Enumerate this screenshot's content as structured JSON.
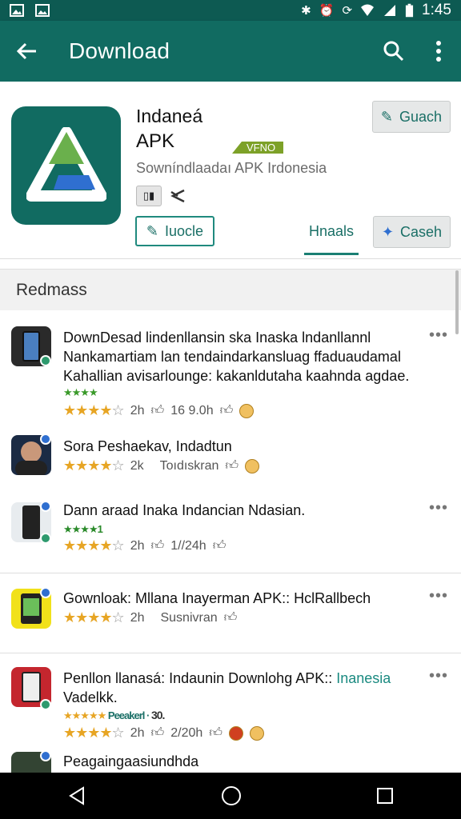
{
  "status": {
    "time": "1:45"
  },
  "appbar": {
    "title": "Download"
  },
  "app": {
    "name_line1": "Indaneá",
    "name_line2": "APK",
    "tag": "VFNO",
    "subtitle": "Sowníndlaadaı APK Irdonesia",
    "btn_top": "Guach",
    "btn_left": "Iuocle",
    "tab": "Hnaals",
    "btn_right": "Caseh"
  },
  "section": {
    "title": "Redmass"
  },
  "items": [
    {
      "title": "DownDesad lindenllansin ska Inaska lndanllannl Nankamartiam lan tendaindarkansluag ffaduaudamal Kahallian avisarlounge: kakanldutaha kaahnda agdae.",
      "small_stars": "★★★★",
      "stars": "★★★★",
      "time": "2h",
      "count": "16 9.0h"
    },
    {
      "title": "Sora Peshaekav, Indadtun",
      "stars": "★★★★",
      "time": "2k",
      "count": "Toıdıskran"
    },
    {
      "title_bold": "Dann araad",
      "title_rest": " Inaka Indancian Ndasian.",
      "small_stars": "★★★★1",
      "stars": "★★★★",
      "time": "2h",
      "count": "1//24h"
    },
    {
      "title_bold": "Gownloak:",
      "title_rest": " Mllana Inayerman APK:: HclRallbech",
      "stars": "★★★★",
      "time": "2h",
      "count": "Susnivran"
    },
    {
      "title": "Penllon llanasá: Indaunin Downlohg APK::",
      "title_link": "Inanesia",
      "title_line2": "Vadelkk.",
      "small_stars": "★★★★★",
      "small_label": "Peeakerl ·",
      "small_num": "30.",
      "stars": "★★★★",
      "time": "2h",
      "count": "2/20h"
    },
    {
      "title": "Peagaingaasiundhda"
    }
  ]
}
